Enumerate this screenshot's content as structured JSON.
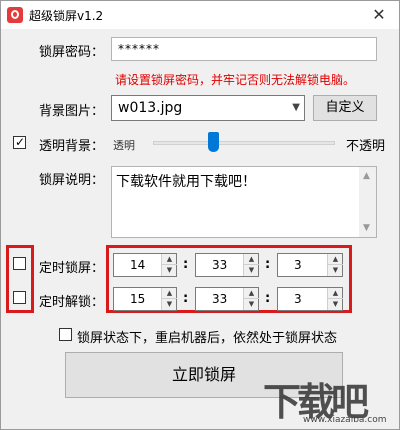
{
  "window": {
    "title": "超级锁屏v1.2",
    "close_glyph": "✕"
  },
  "password": {
    "label": "锁屏密码：",
    "value": "******"
  },
  "warning": "请设置锁屏密码，并牢记否则无法解锁电脑。",
  "background": {
    "label": "背景图片：",
    "selected": "w013.jpg",
    "custom_button": "自定义"
  },
  "transparent": {
    "checked": true,
    "label": "透明背景：",
    "min_label": "透明",
    "max_label": "不透明",
    "level": 0.33
  },
  "description": {
    "label": "锁屏说明：",
    "text": "下载软件就用下载吧！"
  },
  "timed_lock": {
    "checked": false,
    "label": "定时锁屏：",
    "hour": "14",
    "minute": "33",
    "second": "3"
  },
  "timed_unlock": {
    "checked": false,
    "label": "定时解锁：",
    "hour": "15",
    "minute": "33",
    "second": "3"
  },
  "restart_option": {
    "checked": false,
    "label": "锁屏状态下，重启机器后，依然处于锁屏状态"
  },
  "lock_button": "立即锁屏",
  "watermark": {
    "logo": "下载吧",
    "url": "www.xiazaiba.com"
  },
  "colors": {
    "accent": "#0078d7",
    "warning": "#e00000",
    "highlight": "#d91a1a"
  },
  "separator": ":"
}
